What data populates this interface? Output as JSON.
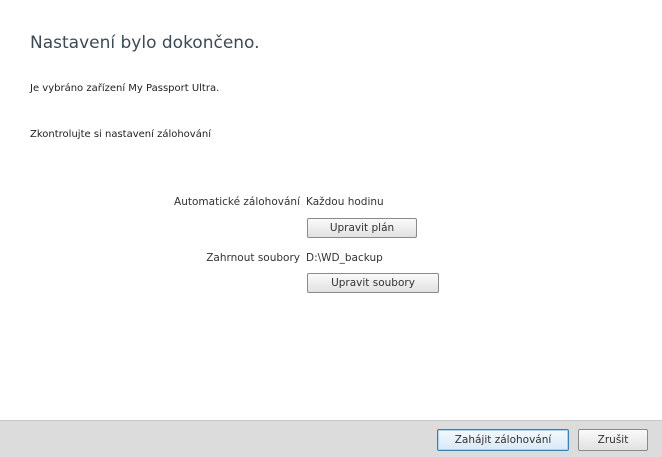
{
  "dialog": {
    "title": "Nastavení bylo dokončeno.",
    "device_text": "Je vybráno zařízení My Passport Ultra.",
    "check_text": "Zkontrolujte si nastavení zálohování"
  },
  "settings": {
    "auto_backup": {
      "label": "Automatické zálohování",
      "value": "Každou hodinu",
      "button_label": "Upravit plán"
    },
    "include_files": {
      "label": "Zahrnout soubory",
      "value": "D:\\WD_backup",
      "button_label": "Upravit soubory"
    }
  },
  "footer": {
    "start_label": "Zahájit zálohování",
    "cancel_label": "Zrušit"
  }
}
